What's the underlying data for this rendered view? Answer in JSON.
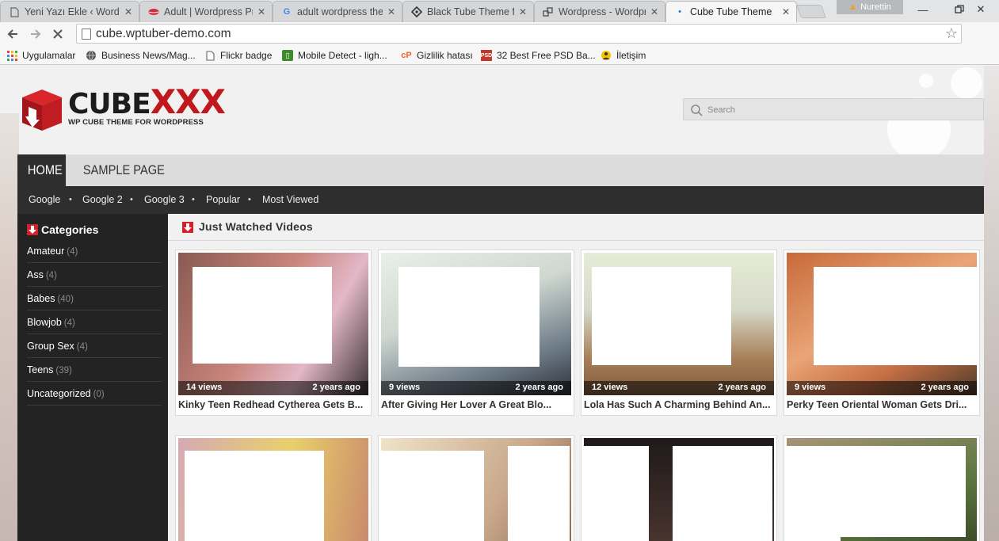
{
  "browser": {
    "tabs": [
      {
        "title": "Yeni Yazı Ekle ‹ Wordp",
        "icon": "page-icon"
      },
      {
        "title": "Adult | Wordpress Pre",
        "icon": "lips-icon"
      },
      {
        "title": "adult wordpress them",
        "icon": "google-icon"
      },
      {
        "title": "Black Tube Theme fo",
        "icon": "diamond-icon"
      },
      {
        "title": "Wordpress - Wordpre",
        "icon": "link-icon"
      },
      {
        "title": "Cube Tube Theme",
        "icon": "loading-icon",
        "active": true
      }
    ],
    "profile_name": "Nurettin",
    "url": "cube.wptuber-demo.com",
    "bookmarks": [
      {
        "label": "Uygulamalar",
        "icon": "apps-grid-icon"
      },
      {
        "label": "Business News/Mag...",
        "icon": "globe-icon"
      },
      {
        "label": "Flickr badge",
        "icon": "page-icon"
      },
      {
        "label": "Mobile Detect - ligh...",
        "icon": "mobile-icon"
      },
      {
        "label": "Gizlilik hatası",
        "icon": "cp-icon"
      },
      {
        "label": "32 Best Free PSD Ba...",
        "icon": "psd-icon"
      },
      {
        "label": "İletişim",
        "icon": "contact-icon"
      }
    ]
  },
  "site": {
    "logo": {
      "word_left": "CUBE",
      "word_right": "XXX",
      "tagline": "WP CUBE THEME FOR WORDPRESS"
    },
    "search_placeholder": "Search",
    "main_nav": [
      {
        "label": "HOME",
        "active": true
      },
      {
        "label": "SAMPLE PAGE",
        "active": false
      }
    ],
    "sub_nav": [
      "Google",
      "Google 2",
      "Google 3",
      "Popular",
      "Most Viewed"
    ],
    "sidebar": {
      "heading": "Categories",
      "categories": [
        {
          "name": "Amateur",
          "count": "(4)"
        },
        {
          "name": "Ass",
          "count": "(4)"
        },
        {
          "name": "Babes",
          "count": "(40)"
        },
        {
          "name": "Blowjob",
          "count": "(4)"
        },
        {
          "name": "Group Sex",
          "count": "(4)"
        },
        {
          "name": "Teens",
          "count": "(39)"
        },
        {
          "name": "Uncategorized",
          "count": "(0)"
        }
      ]
    },
    "content": {
      "heading": "Just Watched Videos",
      "videos": [
        {
          "views": "14 views",
          "ago": "2 years ago",
          "title": "Kinky Teen Redhead Cytherea Gets B...",
          "color_a": "#8a5a52",
          "color_b": "#e3b8c8"
        },
        {
          "views": "9 views",
          "ago": "2 years ago",
          "title": "After Giving Her Lover A Great Blo...",
          "color_a": "#6d7b88",
          "color_b": "#e9efe9"
        },
        {
          "views": "12 views",
          "ago": "2 years ago",
          "title": "Lola Has Such A Charming Behind An...",
          "color_a": "#a67d55",
          "color_b": "#e6ecd7"
        },
        {
          "views": "9 views",
          "ago": "2 years ago",
          "title": "Perky Teen Oriental Woman Gets Dri...",
          "color_a": "#c86a3a",
          "color_b": "#e9a577"
        },
        {
          "views": "",
          "ago": "",
          "title": "",
          "color_a": "#e9d06a",
          "color_b": "#d6a9b5"
        },
        {
          "views": "",
          "ago": "",
          "title": "",
          "color_a": "#caa98c",
          "color_b": "#efe3c8"
        },
        {
          "views": "",
          "ago": "",
          "title": "",
          "color_a": "#1e1a19",
          "color_b": "#4a3530"
        },
        {
          "views": "",
          "ago": "",
          "title": "",
          "color_a": "#5d7740",
          "color_b": "#a89478"
        }
      ]
    }
  },
  "colors": {
    "brand_red": "#c0181c",
    "nav_dark": "#2e2e2f",
    "sidebar_dark": "#232324"
  }
}
